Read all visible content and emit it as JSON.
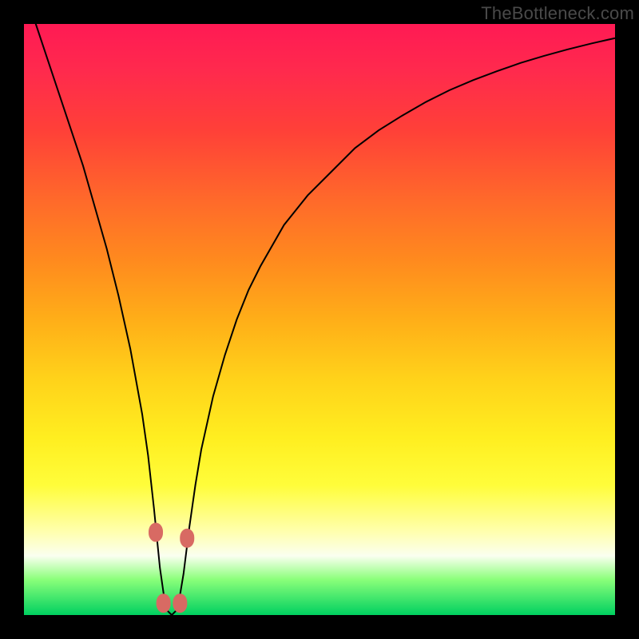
{
  "watermark": "TheBottleneck.com",
  "colors": {
    "frame": "#000000",
    "gradient_top": "#ff1a54",
    "gradient_bottom": "#00d060",
    "curve": "#000000",
    "marker": "#d86a63"
  },
  "chart_data": {
    "type": "line",
    "title": "",
    "xlabel": "",
    "ylabel": "",
    "xlim": [
      0,
      100
    ],
    "ylim": [
      0,
      100
    ],
    "grid": false,
    "legend": false,
    "x": [
      0,
      2,
      4,
      6,
      8,
      10,
      12,
      14,
      16,
      18,
      20,
      21,
      22,
      23,
      24,
      25,
      26,
      27,
      28,
      29,
      30,
      32,
      34,
      36,
      38,
      40,
      44,
      48,
      52,
      56,
      60,
      64,
      68,
      72,
      76,
      80,
      84,
      88,
      92,
      96,
      100
    ],
    "y": [
      106,
      100,
      94,
      88,
      82,
      76,
      69,
      62,
      54,
      45,
      34,
      27,
      18,
      8,
      1,
      0,
      1,
      7,
      15,
      22,
      28,
      37,
      44,
      50,
      55,
      59,
      66,
      71,
      75,
      79,
      82,
      84.5,
      86.8,
      88.8,
      90.5,
      92,
      93.4,
      94.6,
      95.7,
      96.7,
      97.6
    ],
    "markers": {
      "x": [
        22.3,
        23.6,
        26.4,
        27.6
      ],
      "y": [
        14,
        2,
        2,
        13
      ]
    },
    "annotations": []
  }
}
